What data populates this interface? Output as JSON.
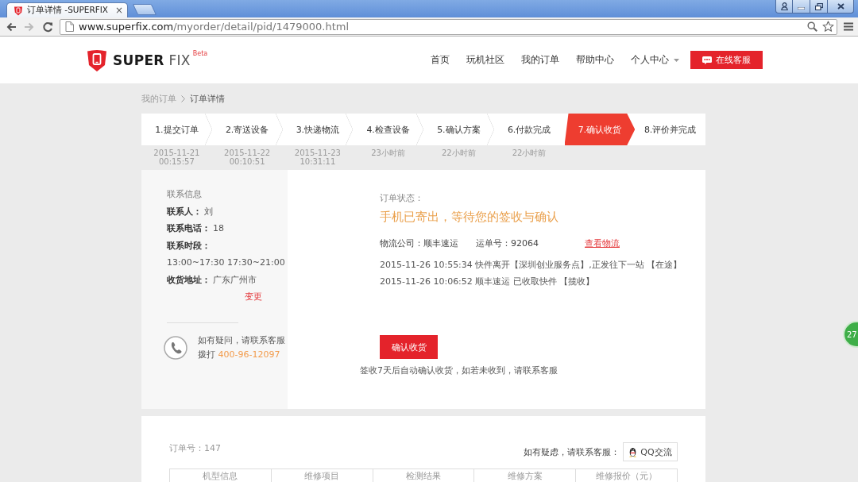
{
  "browser": {
    "tab": {
      "title": "订单详情 -SUPERFIX",
      "close": "×"
    },
    "address": {
      "domain": "www.superfix.com",
      "path": "/myorder/detail/pid/1479000.html"
    }
  },
  "header": {
    "wordmark": "**SUPER** FIX",
    "beta": "Beta",
    "nav": [
      {
        "label": "首页",
        "dropdown": false
      },
      {
        "label": "玩机社区",
        "dropdown": false
      },
      {
        "label": "我的订单",
        "dropdown": false
      },
      {
        "label": "帮助中心",
        "dropdown": false
      },
      {
        "label": "个人中心",
        "dropdown": true
      }
    ],
    "service_button": "在线客服"
  },
  "breadcrumb": [
    {
      "label": "我的订单",
      "kind": "link"
    },
    {
      "label": "订单详情",
      "kind": "current"
    }
  ],
  "steps": [
    {
      "label": "1.提交订单",
      "selected": false,
      "time": "2015-11-21 00:15:57"
    },
    {
      "label": "2.寄送设备",
      "selected": false,
      "time": "2015-11-22 00:10:51"
    },
    {
      "label": "3.快递物流",
      "selected": false,
      "time": "2015-11-23 10:31:11"
    },
    {
      "label": "4.检查设备",
      "selected": false,
      "time": "23小时前"
    },
    {
      "label": "5.确认方案",
      "selected": false,
      "time": "22小时前"
    },
    {
      "label": "6.付款完成",
      "selected": false,
      "time": "22小时前"
    },
    {
      "label": "7.确认收货",
      "selected": true
    },
    {
      "label": "8.评价并完成",
      "selected": false
    }
  ],
  "contact": {
    "title": "联系信息",
    "rows": [
      {
        "kind": "pair",
        "label": "联系人：",
        "value": "刘"
      },
      {
        "kind": "pair",
        "label": "联系电话：",
        "value": "18"
      },
      {
        "kind": "heading",
        "label": "联系时段："
      },
      {
        "kind": "text",
        "value": "13:00~17:30 17:30~21:00"
      },
      {
        "kind": "pair",
        "label": "收货地址：",
        "value": "广东广州市"
      }
    ],
    "change_link": "变更",
    "help": {
      "text": "如有疑问，请联系客服",
      "dial": "拨打",
      "phone": "400-96-12097"
    }
  },
  "status": {
    "label": "订单状态：",
    "headline": "手机已寄出，等待您的签收与确认",
    "courier": "物流公司：顺丰速运",
    "waybill": "运单号：92064",
    "track_link": "查看物流",
    "events": [
      "2015-11-26 10:55:34 快件离开【深圳创业服务点】,正发往下一站 【在途】",
      "2015-11-26 10:06:52 顺丰速运 已收取快件 【揽收】"
    ],
    "confirm_button": "确认收货",
    "note": "签收7天后自动确认收货，如若未收到，请联系客服"
  },
  "order": {
    "number": "订单号：147",
    "help_text": "如有疑虑，请联系客服：",
    "qq_button": "QQ交流",
    "table": {
      "columns": [
        "机型信息",
        "维修项目",
        "检测结果",
        "维修方案",
        "维修报价（元）"
      ]
    }
  },
  "float_badge": {
    "count": "27"
  }
}
